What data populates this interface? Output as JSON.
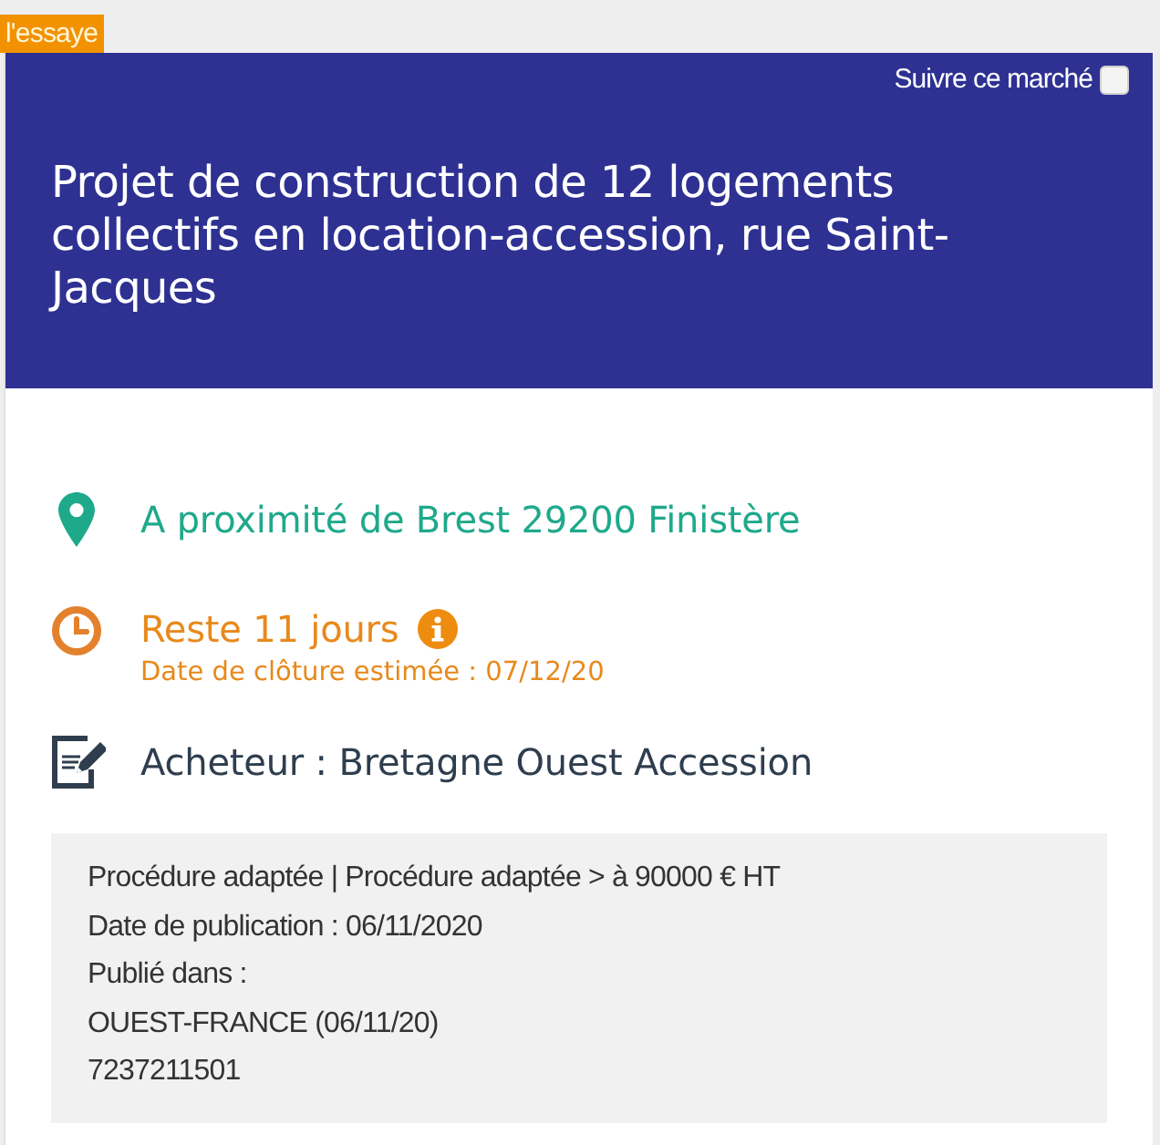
{
  "tag": "l'essaye",
  "header": {
    "follow": {
      "label": "Suivre ce marché",
      "checked": false
    },
    "title": "Projet de construction de 12 logements collectifs en location-accession, rue Saint-Jacques"
  },
  "details": {
    "location": "A proximité de Brest 29200 Finistère",
    "deadline": {
      "remaining": "Reste 11 jours",
      "closing_date": "Date de clôture estimée : 07/12/20"
    },
    "buyer": "Acheteur : Bretagne Ouest Accession"
  },
  "info_box": {
    "lines": [
      "Procédure adaptée | Procédure adaptée > à 90000 € HT",
      "Date de publication : 06/11/2020",
      "Publié dans :",
      "OUEST-FRANCE (06/11/20)",
      "7237211501"
    ]
  }
}
